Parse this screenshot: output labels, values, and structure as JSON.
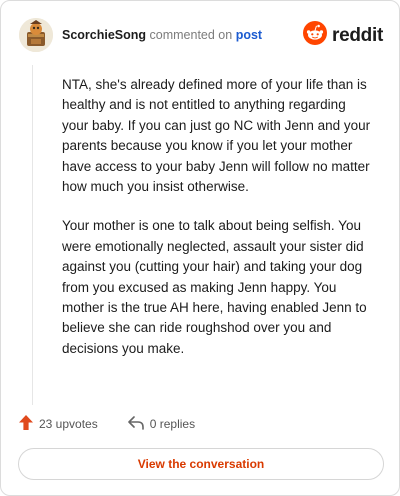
{
  "comment": {
    "username": "ScorchieSong",
    "action": " commented on ",
    "target": "post",
    "paragraphs": [
      "NTA, she's already defined more of your life than is healthy and is not entitled to anything regarding your baby. If you can just go NC with Jenn and your parents because you know if you let your mother have access to your baby Jenn will follow no matter how much you insist otherwise.",
      "Your mother is one to talk about being selfish. You were emotionally neglected, assault your sister did against you (cutting your hair) and taking your dog from you excused as making Jenn happy. You mother is the true AH here, having enabled Jenn to believe she can ride roughshod over you and decisions you make."
    ]
  },
  "brand": {
    "wordmark": "reddit",
    "color": "#ff4500",
    "icon": "reddit-snoo-icon"
  },
  "footer": {
    "upvotes_label": "23 upvotes",
    "replies_label": "0 replies",
    "upvote_icon": "upvote-arrow-icon",
    "reply_icon": "reply-arrow-icon",
    "upvote_color": "#e0491c"
  },
  "cta": {
    "label": "View the conversation",
    "color": "#d93a00"
  }
}
